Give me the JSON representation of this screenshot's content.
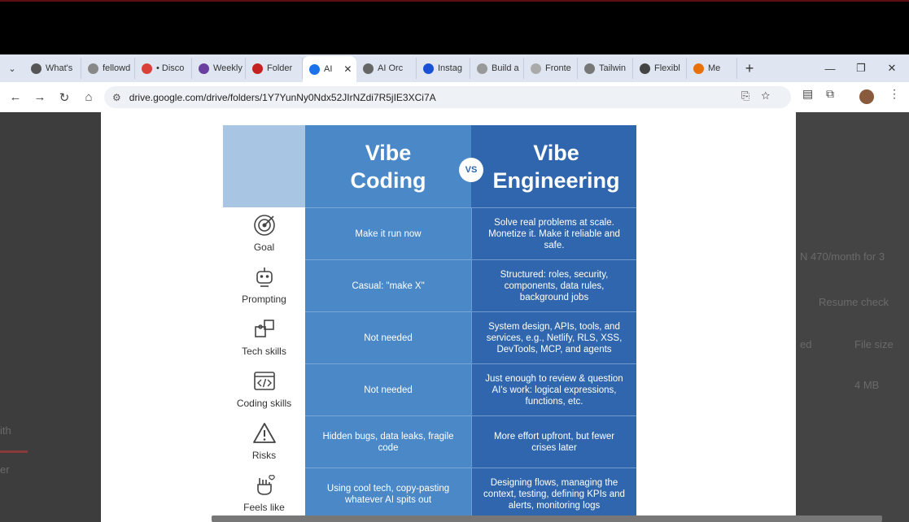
{
  "browser": {
    "tabs": [
      {
        "label": "What's",
        "color": "#555"
      },
      {
        "label": "fellowd",
        "color": "#888"
      },
      {
        "label": "• Disco",
        "color": "#d94037"
      },
      {
        "label": "Weekly",
        "color": "#6b3fa0"
      },
      {
        "label": "Folder",
        "color": "#c5221f"
      },
      {
        "label": "AI",
        "color": "#1a73e8",
        "active": true
      },
      {
        "label": "AI Orc",
        "color": "#666"
      },
      {
        "label": "Instag",
        "color": "#1a4fd8"
      },
      {
        "label": "Build a",
        "color": "#999"
      },
      {
        "label": "Fronte",
        "color": "#aaa"
      },
      {
        "label": "Tailwin",
        "color": "#777"
      },
      {
        "label": "Flexibl",
        "color": "#444"
      },
      {
        "label": "Me",
        "color": "#e8710a"
      }
    ],
    "url": "drive.google.com/drive/folders/1Y7YunNy0Ndx52JIrNZdi7R5jIE3XCi7A"
  },
  "background": {
    "right_texts": [
      "N 470/month for 3",
      "Resume check",
      "ed",
      "File size",
      "4 MB"
    ],
    "left_texts": [
      "ith",
      "er"
    ]
  },
  "table": {
    "col_a_title": [
      "Vibe",
      "Coding"
    ],
    "col_b_title": [
      "Vibe",
      "Engineering"
    ],
    "vs_label": "VS",
    "rows": [
      {
        "label": "Goal",
        "icon": "target-icon",
        "a": "Make it run now",
        "b": "Solve real problems at scale. Monetize it. Make it reliable and safe."
      },
      {
        "label": "Prompting",
        "icon": "robot-icon",
        "a": "Casual: \"make X\"",
        "b": "Structured: roles, security, components, data rules, background jobs"
      },
      {
        "label": "Tech skills",
        "icon": "puzzle-icon",
        "a": "Not needed",
        "b": "System design, APIs, tools, and services, e.g., Netlify, RLS, XSS, DevTools, MCP, and agents"
      },
      {
        "label": "Coding skills",
        "icon": "code-icon",
        "a": "Not needed",
        "b": "Just enough to review & question AI's work: logical expressions, functions, etc."
      },
      {
        "label": "Risks",
        "icon": "warning-icon",
        "a": "Hidden bugs, data leaks, fragile code",
        "b": "More effort upfront, but fewer crises later"
      },
      {
        "label": "Feels like",
        "icon": "rock-hand-icon",
        "a": "Using cool tech, copy-pasting whatever AI spits out",
        "b": "Designing flows, managing the context, testing, defining KPIs and alerts, monitoring logs"
      }
    ]
  },
  "colors": {
    "vibe_coding": "#4a88c8",
    "vibe_engineering": "#2f66ad",
    "header_empty": "#a8c5e3"
  }
}
